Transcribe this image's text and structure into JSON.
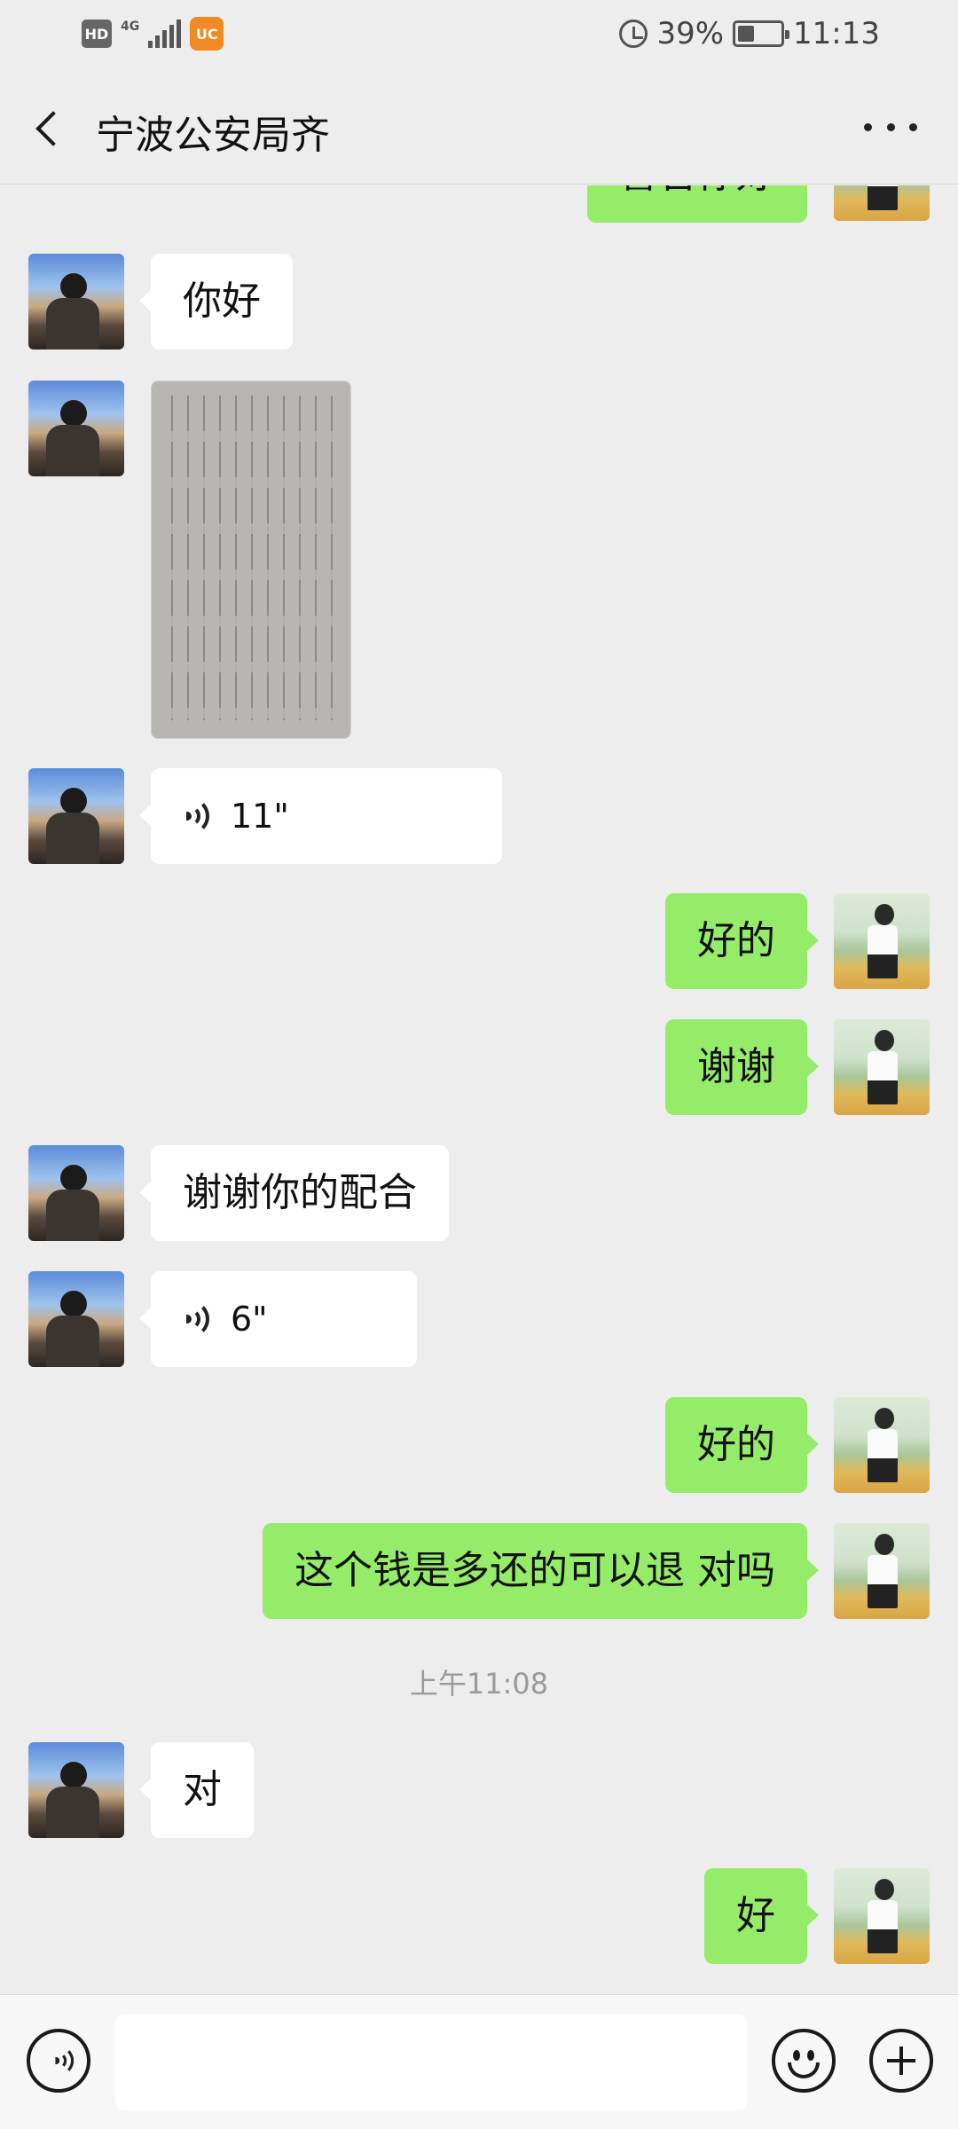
{
  "status_bar": {
    "hd": "HD",
    "network": "4G",
    "battery": "39%",
    "battery_level": 0.39,
    "time": "11:13"
  },
  "header": {
    "title": "宁波公安局齐"
  },
  "messages": [
    {
      "from": "me",
      "type": "text",
      "text": "警官你好"
    },
    {
      "from": "them",
      "type": "text",
      "text": "你好"
    },
    {
      "from": "them",
      "type": "image",
      "icon": "document-photo"
    },
    {
      "from": "them",
      "type": "voice",
      "duration": "11\""
    },
    {
      "from": "me",
      "type": "text",
      "text": "好的"
    },
    {
      "from": "me",
      "type": "text",
      "text": "谢谢"
    },
    {
      "from": "them",
      "type": "text",
      "text": "谢谢你的配合"
    },
    {
      "from": "them",
      "type": "voice",
      "duration": "6\""
    },
    {
      "from": "me",
      "type": "text",
      "text": "好的"
    },
    {
      "from": "me",
      "type": "text",
      "text": "这个钱是多还的可以退 对吗"
    },
    {
      "type": "time",
      "text": "上午11:08"
    },
    {
      "from": "them",
      "type": "text",
      "text": "对"
    },
    {
      "from": "me",
      "type": "text",
      "text": "好"
    }
  ],
  "input_bar": {
    "value": "",
    "icons": [
      "voice-toggle-icon",
      "emoji-icon",
      "plus-icon"
    ]
  },
  "colors": {
    "background": "#ededed",
    "my_bubble": "#95ec69",
    "their_bubble": "#ffffff"
  }
}
